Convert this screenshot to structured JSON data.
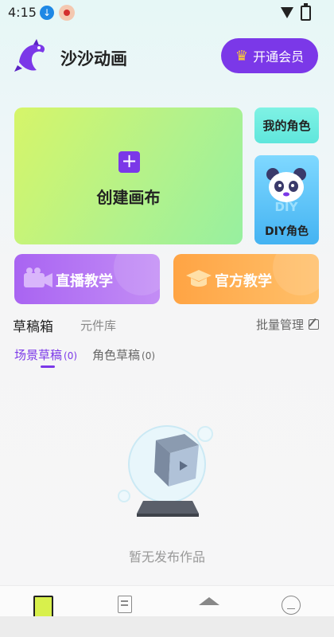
{
  "status_bar": {
    "time": "4:15",
    "download_icon": "download-icon",
    "app_icon": "notification-app-icon"
  },
  "header": {
    "title": "沙沙动画",
    "vip_button": "开通会员",
    "crown_icon": "crown-icon",
    "logo_icon": "dolphin-logo-icon"
  },
  "cards": {
    "create": "创建画布",
    "my_role": "我的角色",
    "diy_role": "DIY角色",
    "live_teaching": "直播教学",
    "official_teaching": "官方教学"
  },
  "tabs": {
    "drafts": "草稿箱",
    "library": "元件库",
    "batch_manage": "批量管理"
  },
  "subtabs": [
    {
      "label": "场景草稿",
      "count": "(0)"
    },
    {
      "label": "角色草稿",
      "count": "(0)"
    }
  ],
  "empty_state": {
    "message": "暂无发布作品"
  },
  "bottom_nav": [
    "home-icon",
    "document-icon",
    "graduation-cap-icon",
    "profile-icon"
  ],
  "colors": {
    "primary_purple": "#7b38e8",
    "green_start": "#d6f569",
    "green_end": "#97f0a0",
    "cyan": "#5fe6dc",
    "blue": "#44b3f2",
    "orange": "#ffa444"
  }
}
